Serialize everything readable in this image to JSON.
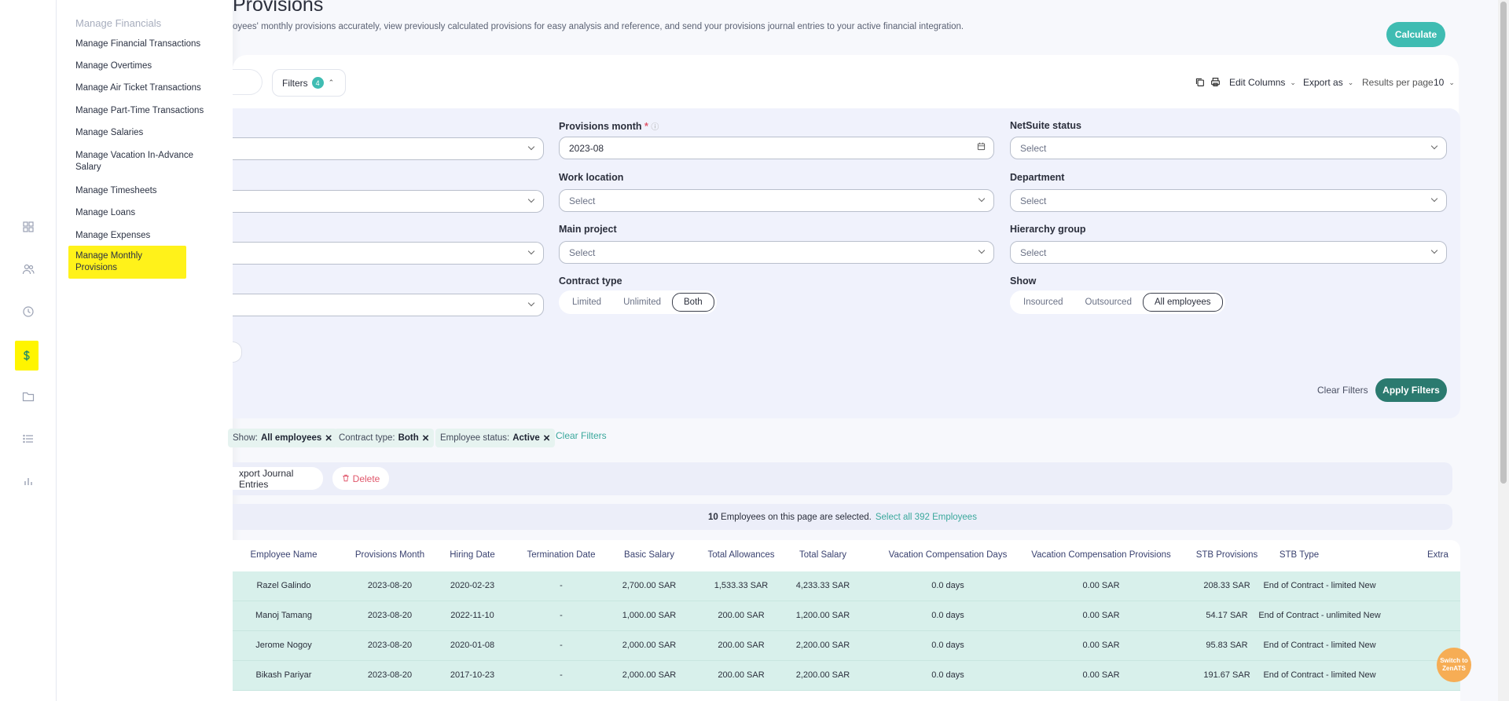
{
  "flyout": {
    "title": "Manage Financials",
    "items": [
      "Manage Financial Transactions",
      "Manage Overtimes",
      "Manage Air Ticket Transactions",
      "Manage Part-Time Transactions",
      "Manage Salaries",
      "Manage Vacation In-Advance Salary",
      "Manage Timesheets",
      "Manage Loans",
      "Manage Expenses",
      "Manage Monthly Provisions"
    ]
  },
  "rail": {
    "icons": [
      "dashboard-icon",
      "people-icon",
      "clock-icon",
      "dollar-icon",
      "folder-icon",
      "list-icon",
      "bar-chart-icon"
    ]
  },
  "page": {
    "title": "Provisions",
    "description": "oyees' monthly provisions accurately, view previously calculated provisions for easy analysis and reference, and send your provisions journal entries to your active financial integration.",
    "calculate_label": "Calculate"
  },
  "toolbar": {
    "filters_label": "Filters",
    "filters_count": "4",
    "edit_columns": "Edit Columns",
    "export_as": "Export as",
    "results_per_page_label": "Results per page",
    "results_per_page_value": "10"
  },
  "filters": {
    "provisions_month_label": "Provisions month",
    "provisions_month_value": "2023-08",
    "netsuite_label": "NetSuite status",
    "work_location_label": "Work location",
    "department_label": "Department",
    "main_project_label": "Main project",
    "hierarchy_label": "Hierarchy group",
    "contract_type_label": "Contract type",
    "contract_options": [
      "Limited",
      "Unlimited",
      "Both"
    ],
    "show_label": "Show",
    "show_options": [
      "Insourced",
      "Outsourced",
      "All employees"
    ],
    "select_placeholder": "Select",
    "clear_filters": "Clear Filters",
    "apply_filters": "Apply Filters"
  },
  "chips": {
    "show_key": "Show:",
    "show_val": "All employees",
    "contract_key": "Contract type:",
    "contract_val": "Both",
    "status_key": "Employee status:",
    "status_val": "Active",
    "clear": "Clear Filters"
  },
  "actions": {
    "export_journal": "xport Journal Entries",
    "delete": "Delete"
  },
  "selection": {
    "count": "10",
    "text": "Employees on this page are selected.",
    "select_all": "Select all 392 Employees"
  },
  "table": {
    "headers": [
      "Employee Name",
      "Provisions Month",
      "Hiring Date",
      "Termination Date",
      "Basic Salary",
      "Total Allowances",
      "Total Salary",
      "Vacation Compensation Days",
      "Vacation Compensation Provisions",
      "STB Provisions",
      "STB Type",
      "Extra"
    ],
    "rows": [
      [
        "Razel Galindo",
        "2023-08-20",
        "2020-02-23",
        "-",
        "2,700.00 SAR",
        "1,533.33 SAR",
        "4,233.33 SAR",
        "0.0 days",
        "0.00 SAR",
        "208.33 SAR",
        "End of Contract - limited New"
      ],
      [
        "Manoj Tamang",
        "2023-08-20",
        "2022-11-10",
        "-",
        "1,000.00 SAR",
        "200.00 SAR",
        "1,200.00 SAR",
        "0.0 days",
        "0.00 SAR",
        "54.17 SAR",
        "End of Contract - unlimited New"
      ],
      [
        "Jerome Nogoy",
        "2023-08-20",
        "2020-01-08",
        "-",
        "2,000.00 SAR",
        "200.00 SAR",
        "2,200.00 SAR",
        "0.0 days",
        "0.00 SAR",
        "95.83 SAR",
        "End of Contract - limited New"
      ],
      [
        "Bikash Pariyar",
        "2023-08-20",
        "2017-10-23",
        "-",
        "2,000.00 SAR",
        "200.00 SAR",
        "2,200.00 SAR",
        "0.0 days",
        "0.00 SAR",
        "191.67 SAR",
        "End of Contract - limited New"
      ]
    ]
  },
  "zen": {
    "line1": "Switch to",
    "line2": "ZenATS"
  }
}
